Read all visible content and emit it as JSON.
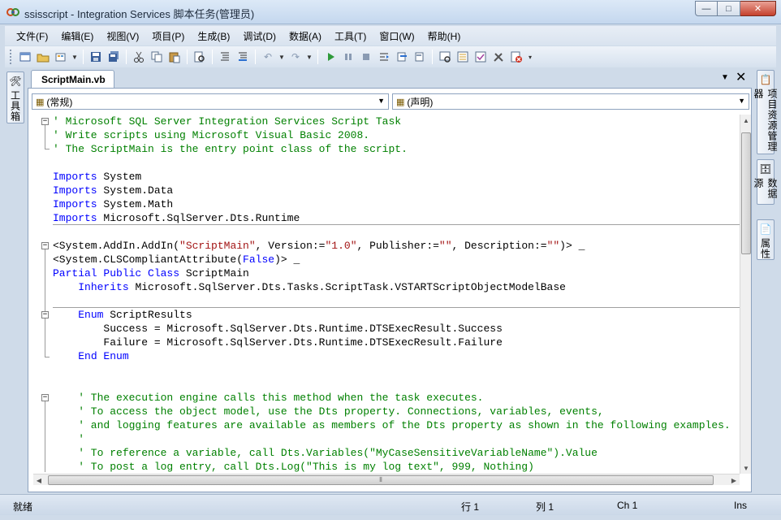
{
  "window": {
    "title": "ssisscript - Integration Services 脚本任务(管理员)",
    "icon": "ssis-app-icon",
    "minimize_glyph": "—",
    "maximize_glyph": "□",
    "close_glyph": "✕"
  },
  "menu": [
    "文件(F)",
    "编辑(E)",
    "视图(V)",
    "项目(P)",
    "生成(B)",
    "调试(D)",
    "数据(A)",
    "工具(T)",
    "窗口(W)",
    "帮助(H)"
  ],
  "toolbar": {
    "icons": [
      "project-icon",
      "open-folder-icon",
      "add-item-icon",
      "save-icon",
      "save-all-icon",
      "cut-icon",
      "copy-icon",
      "paste-icon",
      "find-icon",
      "comment-icon",
      "uncomment-icon",
      "undo-icon",
      "redo-icon",
      "start-debug-icon",
      "break-all-icon",
      "stop-icon",
      "step-into-icon",
      "step-over-icon",
      "step-out-icon",
      "solution-explorer-icon",
      "properties-icon",
      "object-browser-icon",
      "tools-icon",
      "error-list-icon"
    ]
  },
  "left_panel": {
    "toolbox_label": "工具箱"
  },
  "right_panel": {
    "solution_explorer_label": "项目资源管理器",
    "data_sources_label": "数据源",
    "properties_label": "属性"
  },
  "editor": {
    "tab_title": "ScriptMain.vb",
    "left_combo": "(常规)",
    "right_combo": "(声明)",
    "code": [
      [
        {
          "t": "' Microsoft SQL Server Integration Services Script Task",
          "c": "cm"
        }
      ],
      [
        {
          "t": "' Write scripts using Microsoft Visual Basic 2008.",
          "c": "cm"
        }
      ],
      [
        {
          "t": "' The ScriptMain is the entry point class of the script.",
          "c": "cm"
        }
      ],
      [],
      [
        {
          "t": "Imports",
          "c": "kw"
        },
        {
          "t": " System",
          "c": "tx"
        }
      ],
      [
        {
          "t": "Imports",
          "c": "kw"
        },
        {
          "t": " System.Data",
          "c": "tx"
        }
      ],
      [
        {
          "t": "Imports",
          "c": "kw"
        },
        {
          "t": " System.Math",
          "c": "tx"
        }
      ],
      [
        {
          "t": "Imports",
          "c": "kw"
        },
        {
          "t": " Microsoft.SqlServer.Dts.Runtime",
          "c": "tx"
        }
      ],
      [],
      [
        {
          "t": "<System.AddIn.AddIn(",
          "c": "tx"
        },
        {
          "t": "\"ScriptMain\"",
          "c": "st"
        },
        {
          "t": ", Version:=",
          "c": "tx"
        },
        {
          "t": "\"1.0\"",
          "c": "st"
        },
        {
          "t": ", Publisher:=",
          "c": "tx"
        },
        {
          "t": "\"\"",
          "c": "st"
        },
        {
          "t": ", Description:=",
          "c": "tx"
        },
        {
          "t": "\"\"",
          "c": "st"
        },
        {
          "t": ")> _",
          "c": "tx"
        }
      ],
      [
        {
          "t": "<System.CLSCompliantAttribute(",
          "c": "tx"
        },
        {
          "t": "False",
          "c": "kw"
        },
        {
          "t": ")> _",
          "c": "tx"
        }
      ],
      [
        {
          "t": "Partial Public Class",
          "c": "kw"
        },
        {
          "t": " ScriptMain",
          "c": "tx"
        }
      ],
      [
        {
          "t": "    ",
          "c": "tx"
        },
        {
          "t": "Inherits",
          "c": "kw"
        },
        {
          "t": " Microsoft.SqlServer.Dts.Tasks.ScriptTask.VSTARTScriptObjectModelBase",
          "c": "tx"
        }
      ],
      [],
      [
        {
          "t": "    ",
          "c": "tx"
        },
        {
          "t": "Enum",
          "c": "kw"
        },
        {
          "t": " ScriptResults",
          "c": "tx"
        }
      ],
      [
        {
          "t": "        Success = Microsoft.SqlServer.Dts.Runtime.DTSExecResult.Success",
          "c": "tx"
        }
      ],
      [
        {
          "t": "        Failure = Microsoft.SqlServer.Dts.Runtime.DTSExecResult.Failure",
          "c": "tx"
        }
      ],
      [
        {
          "t": "    ",
          "c": "tx"
        },
        {
          "t": "End Enum",
          "c": "kw"
        }
      ],
      [],
      [],
      [
        {
          "t": "    ' The execution engine calls this method when the task executes.",
          "c": "cm"
        }
      ],
      [
        {
          "t": "    ' To access the object model, use the Dts property. Connections, variables, events,",
          "c": "cm"
        }
      ],
      [
        {
          "t": "    ' and logging features are available as members of the Dts property as shown in the following examples.",
          "c": "cm"
        }
      ],
      [
        {
          "t": "    '",
          "c": "cm"
        }
      ],
      [
        {
          "t": "    ' To reference a variable, call Dts.Variables(\"MyCaseSensitiveVariableName\").Value",
          "c": "cm"
        }
      ],
      [
        {
          "t": "    ' To post a log entry, call Dts.Log(\"This is my log text\", 999, Nothing)",
          "c": "cm"
        }
      ]
    ]
  },
  "status": {
    "ready": "就绪",
    "line": "行 1",
    "col": "列 1",
    "ch": "Ch 1",
    "ins": "Ins"
  },
  "colors": {
    "comment": "#008000",
    "keyword": "#0000ff",
    "string": "#a31515"
  }
}
